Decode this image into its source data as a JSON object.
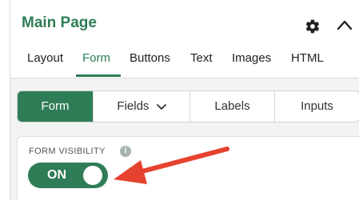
{
  "header": {
    "title": "Main Page",
    "icons": [
      "gear-icon",
      "chevron-up-icon"
    ]
  },
  "tabs": [
    {
      "label": "Layout"
    },
    {
      "label": "Form"
    },
    {
      "label": "Buttons"
    },
    {
      "label": "Text"
    },
    {
      "label": "Images"
    },
    {
      "label": "HTML"
    }
  ],
  "active_tab": "Form",
  "segments": [
    {
      "label": "Form"
    },
    {
      "label": "Fields"
    },
    {
      "label": "Labels"
    },
    {
      "label": "Inputs"
    }
  ],
  "active_segment": "Form",
  "form_visibility": {
    "label": "FORM VISIBILITY",
    "info_icon": "i",
    "toggle_text": "ON"
  },
  "colors": {
    "accent": "#2f7d57",
    "arrow": "#e5432f"
  }
}
